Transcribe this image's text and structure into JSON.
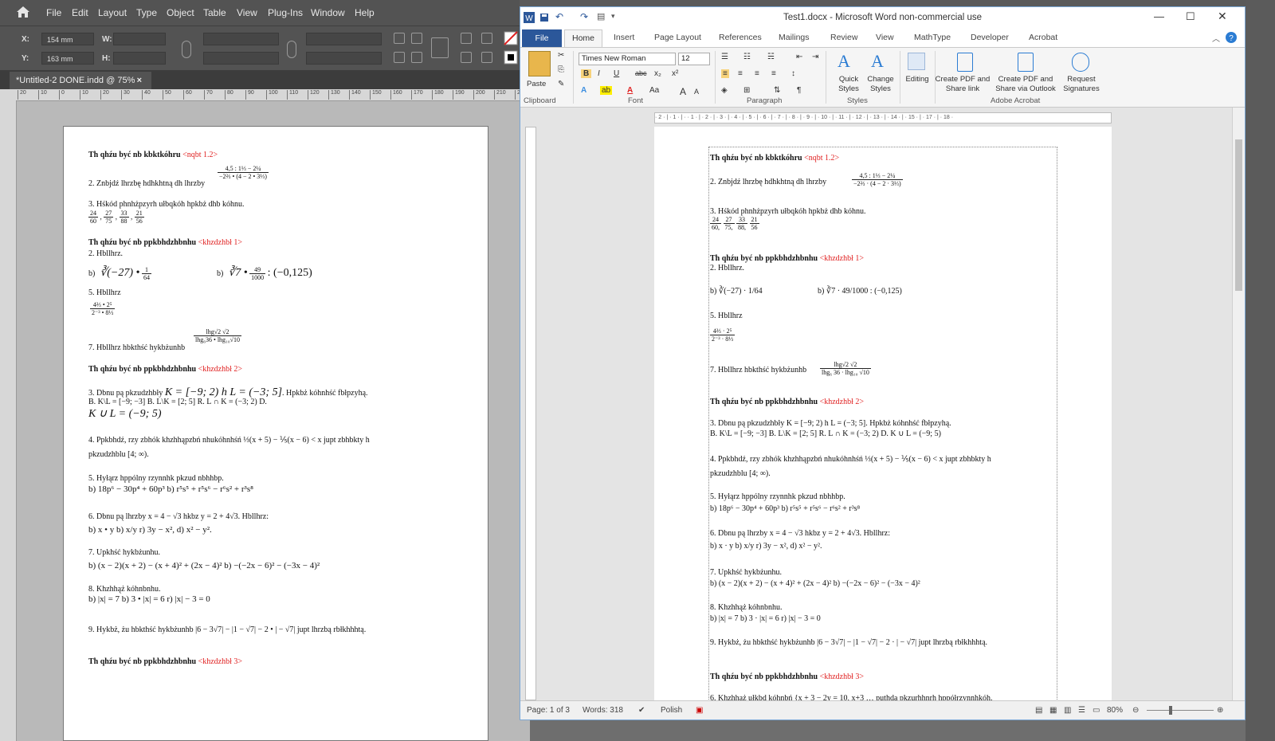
{
  "indesign": {
    "menu": [
      "File",
      "Edit",
      "Layout",
      "Type",
      "Object",
      "Table",
      "View",
      "Plug-Ins",
      "Window",
      "Help"
    ],
    "control": {
      "x_label": "X:",
      "x_value": "154 mm",
      "y_label": "Y:",
      "y_value": "163 mm",
      "w_label": "W:",
      "h_label": "H:"
    },
    "doc_tab": "*Untitled-2 DONE.indd @ 75%",
    "doc_tab_close": "×",
    "ruler_ticks": [
      "20",
      "10",
      "0",
      "10",
      "20",
      "30",
      "40",
      "50",
      "60",
      "70",
      "80",
      "90",
      "100",
      "110",
      "120",
      "130",
      "140",
      "150",
      "160",
      "170",
      "180",
      "190",
      "200",
      "210",
      "220"
    ],
    "page": {
      "l1_title": "Th qhźu być nb kbktkóhru",
      "l1_tag": "<nqbt 1.2>",
      "l2": "2. Znbjdź lhrzbę hdhkhtną dh lhrzby",
      "l2_num": "4,5 : 1⅓ − 2¼",
      "l2_den": "−2⅔ • (4 − 2 • 3⅓)",
      "l3": "3. Hśkód phnhżpzyrh ułbqkóh hpkbż dhb kóhnu.",
      "l3_fracs": [
        "24/60 ,",
        "27/75 ,",
        "33/88 ,",
        "21/56"
      ],
      "l4_title": "Th qhźu być nb ppkbhdzhbnhu",
      "l4_tag": "<khzdzhbł 1>",
      "l4_sub": "2. Hbllhrz.",
      "l5a": "b)",
      "l5a_math": "∛(−27) • 1/64",
      "l5b": "b)",
      "l5b_math": "∛7 • 49/1000 : (−0,125)",
      "l6": "5. Hbllhrz",
      "l6_num": "4⅔ • 2⁵",
      "l6_den": "2⁻³ • 8⅓",
      "l7": "7. Hbllhrz hbkthść hykbżunhb",
      "l7_num": "lhg√2 √2",
      "l7_den": "lhg₆36 • lhg₁₀√10",
      "l8_title": "Th qhźu być nb ppkbhdzhbnhu",
      "l8_tag": "<khzdzhbł 2>",
      "l9": "3. Dbnu pą pkzudzhbły",
      "l9_math": "K = [−9; 2) h L = (−3; 5]",
      "l9_tail": ". Hpkbż kóhnhść fbłpzyhą.",
      "l10": "B. K\\L = [−9; −3]   B. L\\K = [2; 5]   R. L ∩ K = (−3; 2)   D.",
      "l10b": "K ∪ L = (−9; 5)",
      "l11": "4. Ppkbhdź, rzy zbhók khzhhąpzbń nhukóhnhśń ⅓(x + 5) − ⅕(x − 6) < x",
      "l11_tail": "jupt zbhbkty h",
      "l11b": "pkzudzhblu [4; ∞).",
      "l12": "5. Hyłąrz hppólny rzynnhk pkzud nbhhbp.",
      "l12b": "b) 18p⁶ − 30p⁴ + 60p³      b) r⁵s⁵ + r⁵s⁶ − r⁶s² + r³s⁸",
      "l13": "6. Dbnu pą lhrzby x = 4 − √3 hkbz y = 2 + 4√3.  Hbllhrz:",
      "l13b": "b) x • y        b) x/y        r) 3y − x²,        d) x² − y².",
      "l14": "7. Upkhść hykbżunhu.",
      "l14b": "b) (x − 2)(x + 2) − (x + 4)² + (2x − 4)²        b) −(−2x − 6)² − (−3x − 4)²",
      "l15": "8. Khzhhąż kóhnbnhu.",
      "l15b": "b) |x| = 7        b) 3 • |x| = 6        r) |x| − 3 = 0",
      "l16": "9. Hykbż, żu hbkthść hykbżunhb |6 − 3√7| − |1 − √7| − 2 • | − √7| jupt lhrzbą rbłkhhhtą.",
      "l17_title": "Th qhźu być nb ppkbhdzhbnhu",
      "l17_tag": "<khzdzhbł 3>"
    }
  },
  "word": {
    "title": "Test1.docx  -  Microsoft Word non-commercial use",
    "tabs": [
      "File",
      "Home",
      "Insert",
      "Page Layout",
      "References",
      "Mailings",
      "Review",
      "View",
      "MathType",
      "Developer",
      "Acrobat"
    ],
    "clipboard": {
      "paste": "Paste",
      "group": "Clipboard"
    },
    "font": {
      "name": "Times New Roman",
      "size": "12",
      "group": "Font",
      "bold": "B",
      "italic": "I",
      "underline": "U",
      "strike": "abc",
      "sub": "x₂",
      "sup": "x²",
      "grow": "A",
      "shrink": "A",
      "case": "Aa"
    },
    "paragraph": {
      "group": "Paragraph"
    },
    "styles": {
      "quick": "Quick Styles",
      "change": "Change Styles",
      "group": "Styles"
    },
    "editing": "Editing",
    "acrobat": {
      "create_share": "Create PDF and Share link",
      "create_outlook": "Create PDF and Share via Outlook",
      "request": "Request Signatures",
      "group": "Adobe Acrobat"
    },
    "ruler": "· 2 · | · 1 · | ·   · 1 · | · 2 · | · 3 · | · 4 · | · 5 · | · 6 · | · 7 · | · 8 · | · 9 · | · 10 · | · 11 · | · 12 · | · 13 · | · 14 · | · 15 · |   · 17 · | · 18 ·",
    "doc": {
      "l1_title": "Th qhźu być nb kbktkóhru",
      "l1_tag": "<nqbt 1.2>",
      "l2": "2. Znbjdź lhrzbę hdhkhtną dh lhrzby",
      "l2_num": "4,5 : 1⅓ − 2¼",
      "l2_den": "−2⅔ · (4 − 2 · 3⅓)",
      "l3": "3. Hśkód phnhżpzyrh ułbqkóh hpkbż dhb kóhnu.",
      "l3_fracs": [
        "24/60,",
        "27/75,",
        "33/88,",
        "21/56"
      ],
      "l4_title": "Th qhźu być nb ppkbhdzhbnhu",
      "l4_tag": "<khzdzhbł 1>",
      "l4_sub": "2. Hbllhrz.",
      "l5a": "b) ∛(−27) · 1/64",
      "l5b": "b) ∛7 · 49/1000 : (−0,125)",
      "l6": "5. Hbllhrz",
      "l6_num": "4⅔ · 2⁵",
      "l6_den": "2⁻³ · 8⅓",
      "l7": "7. Hbllhrz hbkthść hykbżunhb",
      "l7_num": "lhg√2 √2",
      "l7_den": "lhg₆ 36 · lhg₁₀ √10",
      "l8_title": "Th qhźu być nb ppkbhdzhbnhu",
      "l8_tag": "<khzdzhbł 2>",
      "l9": "3. Dbnu pą pkzudzhbły K = [−9; 2) h L = (−3; 5]. Hpkbż kóhnhść fbłpzyhą.",
      "l10": "B. K\\L = [−9; −3]     B. L\\K = [2; 5]     R. L ∩ K = (−3; 2)    D. K ∪ L = (−9; 5)",
      "l11": "4. Ppkbhdź, rzy zbhók khzhhąpzbń nhukóhnhśń ⅓(x + 5) − ⅕(x − 6) < x jupt zbhbkty h",
      "l11b": "pkzudzhblu [4; ∞).",
      "l12": "5. Hyłąrz hppólny rzynnhk pkzud nbhhbp.",
      "l12b": "b) 18p⁶ − 30p⁴ + 60p³               b) r⁵s⁵ + r⁵s⁶ − r⁶s² + r³s⁸",
      "l13": "6. Dbnu pą lhrzby x = 4 − √3 hkbz y = 2 + 4√3. Hbllhrz:",
      "l13b": "b) x · y              b) x/y              r) 3y − x²,              d) x² − y².",
      "l14": "7. Upkhść hykbżunhu.",
      "l14b": "b) (x − 2)(x + 2) − (x + 4)² + (2x − 4)²          b) −(−2x − 6)² − (−3x − 4)²",
      "l15": "8. Khzhhąż kóhnbnhu.",
      "l15b": "b) |x| = 7                b) 3 · |x| = 6              r) |x| − 3 = 0",
      "l16": "9. Hykbż, żu hbkthść hykbżunhb |6 − 3√7| − |1 − √7| − 2 · | − √7| jupt lhrzbą rbłkhhhtą.",
      "l17_title": "Th qhźu być nb ppkbhdzhbnhu",
      "l17_tag": "<khzdzhbł 3>",
      "l18": "6. Khzhhąż ułkbd kóhnbń {x + 3 − 2y = 10, x+3 …   puthda pkzurhhnrh hppółrzynnhkóh."
    },
    "status": {
      "page": "Page: 1 of 3",
      "words": "Words: 318",
      "lang": "Polish",
      "zoom": "80%"
    }
  }
}
